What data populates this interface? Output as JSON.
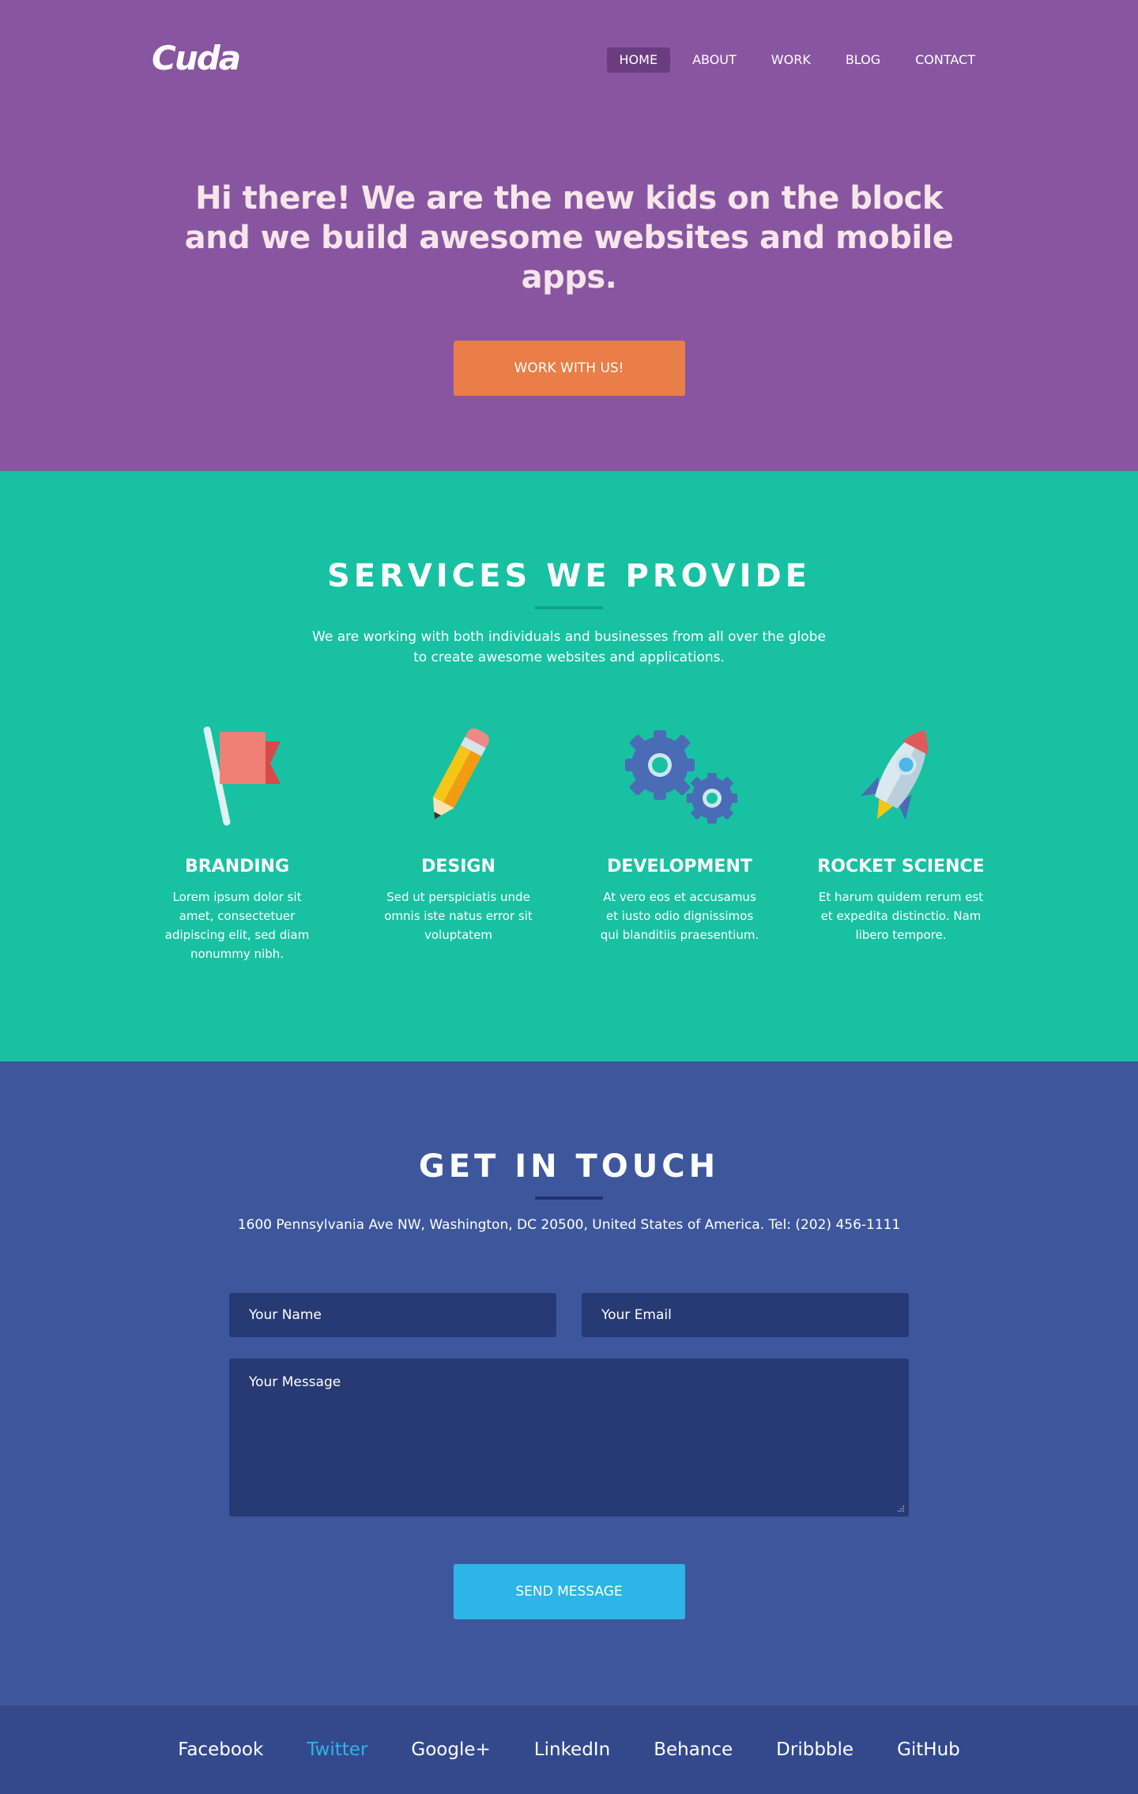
{
  "brand": {
    "name": "Cuda"
  },
  "nav": {
    "items": [
      {
        "label": "HOME",
        "active": true
      },
      {
        "label": "ABOUT",
        "active": false
      },
      {
        "label": "WORK",
        "active": false
      },
      {
        "label": "BLOG",
        "active": false
      },
      {
        "label": "CONTACT",
        "active": false
      }
    ]
  },
  "hero": {
    "line1": "Hi there! We are the new kids on the block",
    "line2": "and we build awesome websites and mobile apps.",
    "cta": "WORK WITH US!"
  },
  "services": {
    "title": "SERVICES WE PROVIDE",
    "lead_line1": "We are working with both individuals and businesses from all over the globe",
    "lead_line2": "to create awesome websites and applications.",
    "items": [
      {
        "icon": "flag-icon",
        "title": "BRANDING",
        "text": "Lorem ipsum dolor sit amet, consectetuer adipiscing elit, sed diam nonummy nibh."
      },
      {
        "icon": "pencil-icon",
        "title": "DESIGN",
        "text": "Sed ut perspiciatis unde omnis iste natus error sit voluptatem"
      },
      {
        "icon": "gears-icon",
        "title": "DEVELOPMENT",
        "text": "At vero eos et accusamus et iusto odio dignissimos qui blanditiis praesentium."
      },
      {
        "icon": "rocket-icon",
        "title": "ROCKET SCIENCE",
        "text": "Et harum quidem rerum est et expedita distinctio. Nam libero tempore."
      }
    ]
  },
  "contact": {
    "title": "GET IN TOUCH",
    "address": "1600 Pennsylvania Ave NW, Washington, DC 20500, United States of America. Tel: (202) 456-1111",
    "name_placeholder": "Your Name",
    "email_placeholder": "Your Email",
    "message_placeholder": "Your Message",
    "send": "SEND MESSAGE"
  },
  "footer": {
    "links": [
      {
        "label": "Facebook",
        "highlight": false
      },
      {
        "label": "Twitter",
        "highlight": true
      },
      {
        "label": "Google+",
        "highlight": false
      },
      {
        "label": "LinkedIn",
        "highlight": false
      },
      {
        "label": "Behance",
        "highlight": false
      },
      {
        "label": "Dribbble",
        "highlight": false
      },
      {
        "label": "GitHub",
        "highlight": false
      }
    ]
  },
  "colors": {
    "hero_bg": "#8856a0",
    "services_bg": "#18c1a2",
    "contact_bg": "#3e579c",
    "footer_bg": "#34498c",
    "accent_orange": "#ea7e48",
    "accent_blue": "#2cb5e6"
  }
}
